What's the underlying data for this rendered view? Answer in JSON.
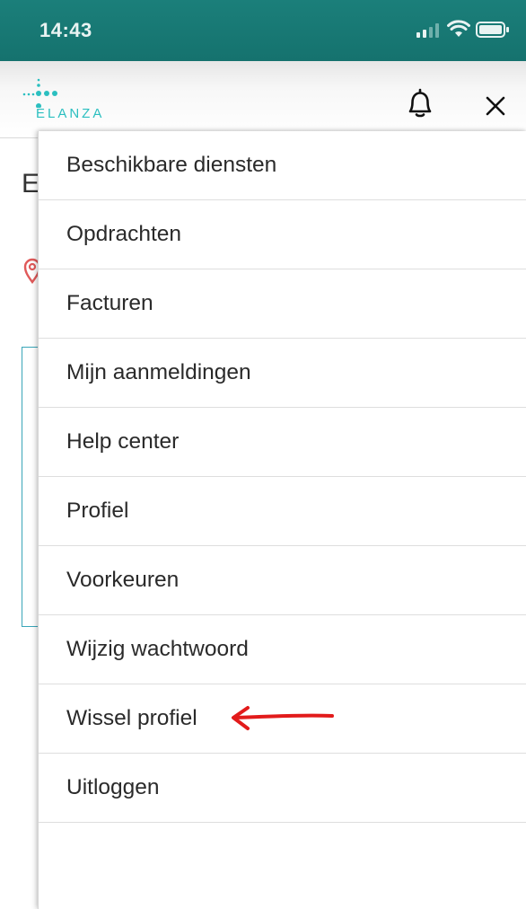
{
  "status_bar": {
    "time": "14:43",
    "icons": [
      "signal-icon",
      "wifi-icon",
      "battery-icon"
    ]
  },
  "header": {
    "logo_text": "ELANZA",
    "brand_color": "#2bbfc0",
    "icons": [
      "bell-icon",
      "close-icon"
    ]
  },
  "background_page": {
    "title_initial": "E"
  },
  "menu": {
    "items": [
      {
        "label": "Beschikbare diensten"
      },
      {
        "label": "Opdrachten"
      },
      {
        "label": "Facturen"
      },
      {
        "label": "Mijn aanmeldingen"
      },
      {
        "label": "Help center"
      },
      {
        "label": "Profiel"
      },
      {
        "label": "Voorkeuren"
      },
      {
        "label": "Wijzig wachtwoord"
      },
      {
        "label": "Wissel profiel"
      },
      {
        "label": "Uitloggen"
      }
    ]
  },
  "annotation": {
    "arrow_color": "#e21b1b",
    "points_to": "Wissel profiel"
  }
}
